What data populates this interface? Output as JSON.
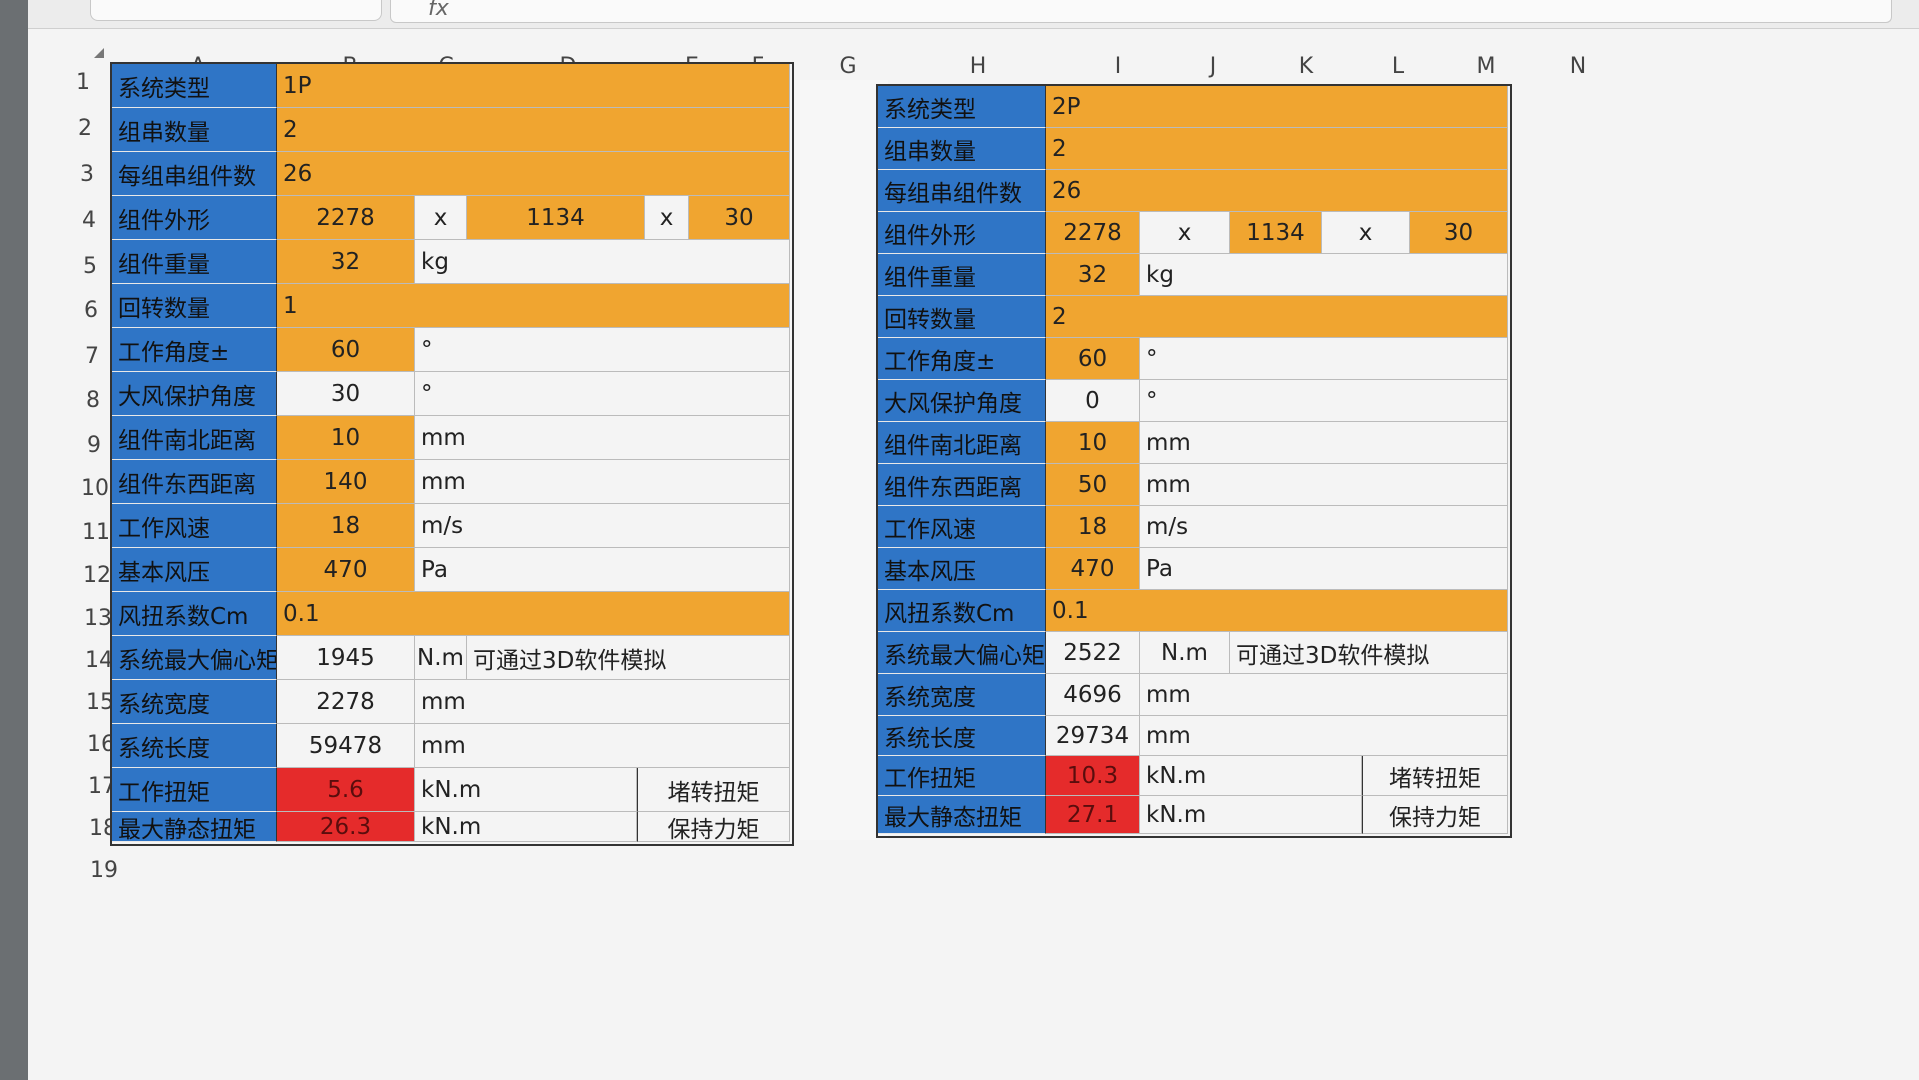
{
  "formula_bar": {
    "name_value": "",
    "fx_label": "fx"
  },
  "columns": [
    "A",
    "B",
    "C",
    "D",
    "E",
    "F",
    "G",
    "H",
    "I",
    "J",
    "K",
    "L",
    "M",
    "N"
  ],
  "rows": [
    "1",
    "2",
    "3",
    "4",
    "5",
    "6",
    "7",
    "8",
    "9",
    "10",
    "11",
    "12",
    "13",
    "14",
    "15",
    "16",
    "17",
    "18",
    "19"
  ],
  "left_table": {
    "labels": [
      "系统类型",
      "组串数量",
      "每组串组件数",
      "组件外形",
      "组件重量",
      "回转数量",
      "工作角度±",
      "大风保护角度",
      "组件南北距离",
      "组件东西距离",
      "工作风速",
      "基本风压",
      "风扭系数Cm",
      "系统最大偏心矩",
      "系统宽度",
      "系统长度",
      "工作扭矩",
      "最大静态扭矩"
    ],
    "system_type": "1P",
    "strings": "2",
    "modules_per_string": "26",
    "dim_1": "2278",
    "dim_x1": "x",
    "dim_2": "1134",
    "dim_x2": "x",
    "dim_3": "30",
    "weight": "32",
    "weight_unit": "kg",
    "rotations": "1",
    "work_angle": "60",
    "work_angle_unit": "°",
    "wind_angle": "30",
    "wind_angle_unit": "°",
    "ns_dist": "10",
    "ns_unit": "mm",
    "ew_dist": "140",
    "ew_unit": "mm",
    "wind_speed": "18",
    "wind_speed_unit": "m/s",
    "wind_pressure": "470",
    "wind_pressure_unit": "Pa",
    "cm": "0.1",
    "ecc": "1945",
    "ecc_unit": "N.m",
    "ecc_note": "可通过3D软件模拟",
    "width": "2278",
    "width_unit": "mm",
    "length": "59478",
    "length_unit": "mm",
    "torque": "5.6",
    "torque_unit": "kN.m",
    "torque_note": "堵转扭矩",
    "static_torque": "26.3",
    "static_torque_unit": "kN.m",
    "static_torque_note": "保持力矩"
  },
  "right_table": {
    "labels": [
      "系统类型",
      "组串数量",
      "每组串组件数",
      "组件外形",
      "组件重量",
      "回转数量",
      "工作角度±",
      "大风保护角度",
      "组件南北距离",
      "组件东西距离",
      "工作风速",
      "基本风压",
      "风扭系数Cm",
      "系统最大偏心矩",
      "系统宽度",
      "系统长度",
      "工作扭矩",
      "最大静态扭矩"
    ],
    "system_type": "2P",
    "strings": "2",
    "modules_per_string": "26",
    "dim_1": "2278",
    "dim_x1": "x",
    "dim_2": "1134",
    "dim_x2": "x",
    "dim_3": "30",
    "weight": "32",
    "weight_unit": "kg",
    "rotations": "2",
    "work_angle": "60",
    "work_angle_unit": "°",
    "wind_angle": "0",
    "wind_angle_unit": "°",
    "ns_dist": "10",
    "ns_unit": "mm",
    "ew_dist": "50",
    "ew_unit": "mm",
    "wind_speed": "18",
    "wind_speed_unit": "m/s",
    "wind_pressure": "470",
    "wind_pressure_unit": "Pa",
    "cm": "0.1",
    "ecc": "2522",
    "ecc_unit": "N.m",
    "ecc_note": "可通过3D软件模拟",
    "width": "4696",
    "width_unit": "mm",
    "length": "29734",
    "length_unit": "mm",
    "torque": "10.3",
    "torque_unit": "kN.m",
    "torque_note": "堵转扭矩",
    "static_torque": "27.1",
    "static_torque_unit": "kN.m",
    "static_torque_note": "保持力矩"
  },
  "colors": {
    "label_blue": "#2f75c6",
    "input_orange": "#f0a530",
    "result_red": "#e52b2b"
  }
}
